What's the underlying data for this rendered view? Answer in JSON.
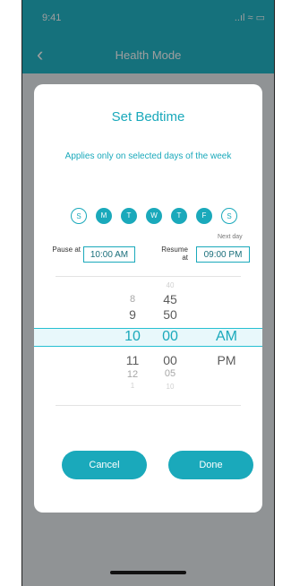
{
  "status": {
    "time": "9:41",
    "icons": "..ıl ≈ ▭"
  },
  "nav": {
    "back_icon": "‹",
    "title": "Health Mode"
  },
  "dialog": {
    "title": "Set Bedtime",
    "subtitle": "Applies only on selected days of the week",
    "days": [
      "S",
      "M",
      "T",
      "W",
      "T",
      "F",
      "S"
    ],
    "active_days": [
      false,
      true,
      true,
      true,
      true,
      true,
      false
    ],
    "pause_label": "Pause at",
    "resume_label": "Resume at",
    "next_day": "Next day",
    "pause_time": "10:00 AM",
    "resume_time": "09:00 PM",
    "picker": {
      "hours": [
        "8",
        "9",
        "10",
        "11",
        "12",
        "1"
      ],
      "minutes": [
        "40",
        "45",
        "50",
        "00",
        "00",
        "05",
        "10"
      ],
      "ampm": [
        "AM",
        "PM"
      ],
      "selected": {
        "hour": "10",
        "minute": "00",
        "ampm": "AM"
      }
    },
    "buttons": {
      "cancel": "Cancel",
      "done": "Done"
    }
  },
  "colors": {
    "accent": "#1aa9bb",
    "highlight": "#e8f8fb"
  }
}
